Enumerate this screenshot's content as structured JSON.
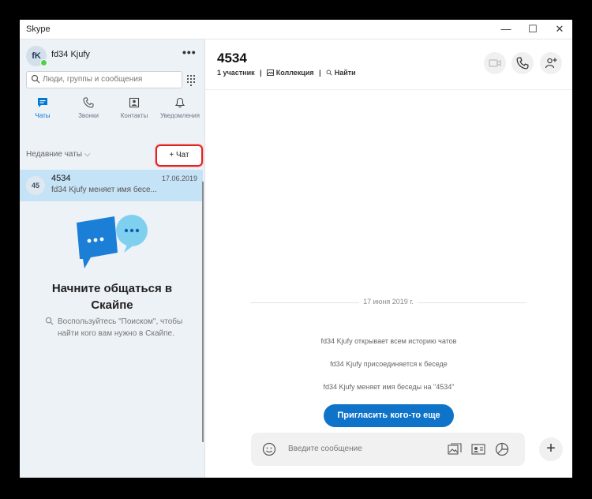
{
  "window": {
    "title": "Skype",
    "minimize": "—",
    "maximize": "☐",
    "close": "✕"
  },
  "profile": {
    "initials": "fK",
    "name": "fd34 Kjufy",
    "more": "•••"
  },
  "search": {
    "placeholder": "Люди, группы и сообщения"
  },
  "nav": {
    "tabs": [
      {
        "label": "Чаты",
        "icon": "chat-icon",
        "active": true
      },
      {
        "label": "Звонки",
        "icon": "phone-icon",
        "active": false
      },
      {
        "label": "Контакты",
        "icon": "contacts-icon",
        "active": false
      },
      {
        "label": "Уведомления",
        "icon": "bell-icon",
        "active": false
      }
    ]
  },
  "recent": {
    "label": "Недавние чаты",
    "chevron": "⌵",
    "new_chat_label": "+ Чат"
  },
  "chat_list": [
    {
      "initials": "45",
      "name": "4534",
      "date": "17.06.2019",
      "preview": "fd34 Kjufy меняет имя бесе..."
    }
  ],
  "empty_state": {
    "title_line1": "Начните общаться в",
    "title_line2": "Скайпе",
    "desc": "Воспользуйтесь \"Поиском\", чтобы найти кого вам нужно в Скайпе."
  },
  "conversation": {
    "title": "4534",
    "participants": "1 участник",
    "sep": "|",
    "collection": "Коллекция",
    "find": "Найти",
    "date_divider": "17 июня 2019 г.",
    "messages": [
      "fd34 Kjufy открывает всем историю чатов",
      "fd34 Kjufy присоединяется к беседе",
      "fd34 Kjufy меняет имя беседы на \"4534\""
    ],
    "invite_label": "Пригласить кого-то еще",
    "composer_placeholder": "Введите сообщение",
    "plus": "+"
  },
  "colors": {
    "accent": "#0078d4",
    "invite_button": "#0f74c9",
    "selected_chat": "#c5e3f6",
    "highlight_border": "#e02424",
    "sidebar_bg": "#edf2f7"
  }
}
